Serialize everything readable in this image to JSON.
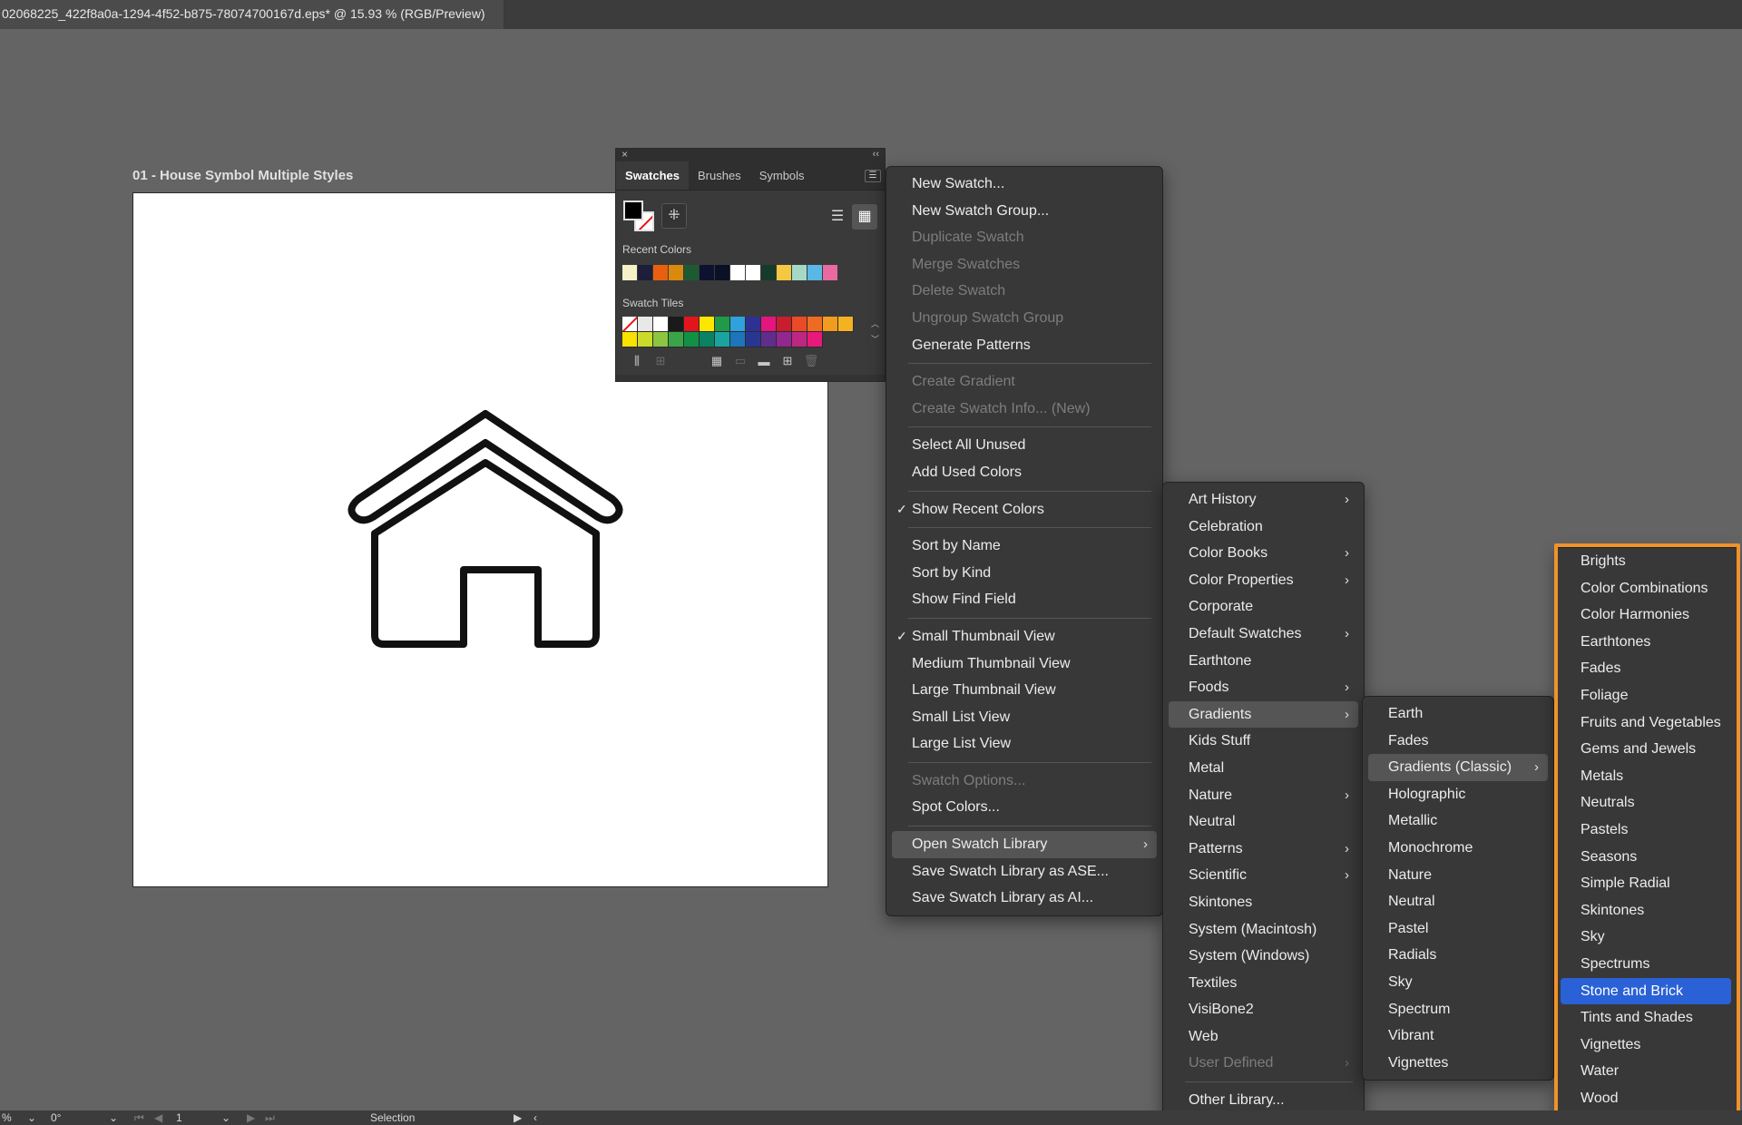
{
  "document": {
    "tab_title": "02068225_422f8a0a-1294-4f52-b875-78074700167d.eps* @ 15.93 % (RGB/Preview)",
    "artboard_label": "01 - House Symbol Multiple Styles"
  },
  "swatches_panel": {
    "close_glyph": "×",
    "collapse_glyph": "‹‹",
    "tabs": [
      "Swatches",
      "Brushes",
      "Symbols"
    ],
    "recent_colors_label": "Recent Colors",
    "swatch_tiles_label": "Swatch Tiles",
    "recent_colors": [
      "#f5f1c8",
      "#1c1e3a",
      "#e8600e",
      "#d98a0e",
      "#1d5a33",
      "#0d1230",
      "#0a1026",
      "#ffffff",
      "#ffffff",
      "#173b2a",
      "#f4c842",
      "#a6d8c8",
      "#5ab8e4",
      "#e86aa0"
    ],
    "tile_colors": [
      "none",
      "#e8e8e8",
      "#ffffff",
      "#1a1a1a",
      "#e1161c",
      "#ffe600",
      "#1f9a48",
      "#2da2dc",
      "#2e3192",
      "#e4167e",
      "#c91d2d",
      "#ea4b26",
      "#ef6b22",
      "#f29c1f",
      "#f4b223",
      "#f9e100",
      "#cbdb2a",
      "#8ec540",
      "#3aa548",
      "#119146",
      "#0a8264",
      "#1aa4a0",
      "#1d75bc",
      "#27378f",
      "#5f2e8d",
      "#91278f",
      "#bd2783",
      "#e7197c"
    ]
  },
  "main_menu": {
    "items": [
      {
        "label": "New Swatch...",
        "disabled": false
      },
      {
        "label": "New Swatch Group...",
        "disabled": false
      },
      {
        "label": "Duplicate Swatch",
        "disabled": true
      },
      {
        "label": "Merge Swatches",
        "disabled": true
      },
      {
        "label": "Delete Swatch",
        "disabled": true
      },
      {
        "label": "Ungroup Swatch Group",
        "disabled": true
      },
      {
        "label": "Generate Patterns",
        "disabled": false
      },
      {
        "label": "Create Gradient",
        "disabled": true
      },
      {
        "label": "Create Swatch Info... (New)",
        "disabled": true
      },
      {
        "label": "Select All Unused",
        "disabled": false
      },
      {
        "label": "Add Used Colors",
        "disabled": false
      },
      {
        "label": "Show Recent Colors",
        "checked": true
      },
      {
        "label": "Sort by Name",
        "disabled": false
      },
      {
        "label": "Sort by Kind",
        "disabled": false
      },
      {
        "label": "Show Find Field",
        "disabled": false
      },
      {
        "label": "Small Thumbnail View",
        "checked": true
      },
      {
        "label": "Medium Thumbnail View",
        "disabled": false
      },
      {
        "label": "Large Thumbnail View",
        "disabled": false
      },
      {
        "label": "Small List View",
        "disabled": false
      },
      {
        "label": "Large List View",
        "disabled": false
      },
      {
        "label": "Swatch Options...",
        "disabled": true
      },
      {
        "label": "Spot Colors...",
        "disabled": false
      },
      {
        "label": "Open Swatch Library",
        "submenu": true,
        "highlight": true
      },
      {
        "label": "Save Swatch Library as ASE...",
        "disabled": false
      },
      {
        "label": "Save Swatch Library as AI...",
        "disabled": false
      }
    ],
    "check_glyph": "✓",
    "chevron_glyph": "›"
  },
  "library_menu": {
    "items": [
      {
        "label": "Art History",
        "submenu": true
      },
      {
        "label": "Celebration"
      },
      {
        "label": "Color Books",
        "submenu": true
      },
      {
        "label": "Color Properties",
        "submenu": true
      },
      {
        "label": "Corporate"
      },
      {
        "label": "Default Swatches",
        "submenu": true
      },
      {
        "label": "Earthtone"
      },
      {
        "label": "Foods",
        "submenu": true
      },
      {
        "label": "Gradients",
        "submenu": true,
        "highlight": true
      },
      {
        "label": "Kids Stuff"
      },
      {
        "label": "Metal"
      },
      {
        "label": "Nature",
        "submenu": true
      },
      {
        "label": "Neutral"
      },
      {
        "label": "Patterns",
        "submenu": true
      },
      {
        "label": "Scientific",
        "submenu": true
      },
      {
        "label": "Skintones"
      },
      {
        "label": "System (Macintosh)"
      },
      {
        "label": "System (Windows)"
      },
      {
        "label": "Textiles"
      },
      {
        "label": "VisiBone2"
      },
      {
        "label": "Web"
      },
      {
        "label": "User Defined",
        "submenu": true,
        "disabled": true
      },
      {
        "label": "Other Library..."
      }
    ]
  },
  "gradients_menu": {
    "items": [
      {
        "label": "Earth"
      },
      {
        "label": "Fades"
      },
      {
        "label": "Gradients (Classic)",
        "submenu": true,
        "highlight": true
      },
      {
        "label": "Holographic"
      },
      {
        "label": "Metallic"
      },
      {
        "label": "Monochrome"
      },
      {
        "label": "Nature"
      },
      {
        "label": "Neutral"
      },
      {
        "label": "Pastel"
      },
      {
        "label": "Radials"
      },
      {
        "label": "Sky"
      },
      {
        "label": "Spectrum"
      },
      {
        "label": "Vibrant"
      },
      {
        "label": "Vignettes"
      }
    ]
  },
  "classic_menu": {
    "items": [
      {
        "label": "Brights"
      },
      {
        "label": "Color Combinations"
      },
      {
        "label": "Color Harmonies"
      },
      {
        "label": "Earthtones"
      },
      {
        "label": "Fades"
      },
      {
        "label": "Foliage"
      },
      {
        "label": "Fruits and Vegetables"
      },
      {
        "label": "Gems and Jewels"
      },
      {
        "label": "Metals"
      },
      {
        "label": "Neutrals"
      },
      {
        "label": "Pastels"
      },
      {
        "label": "Seasons"
      },
      {
        "label": "Simple Radial"
      },
      {
        "label": "Skintones"
      },
      {
        "label": "Sky"
      },
      {
        "label": "Spectrums"
      },
      {
        "label": "Stone and Brick",
        "selected": true
      },
      {
        "label": "Tints and Shades"
      },
      {
        "label": "Vignettes"
      },
      {
        "label": "Water"
      },
      {
        "label": "Wood"
      }
    ]
  },
  "status_bar": {
    "zoom": "%",
    "rotation": "0°",
    "artboard_number": "1",
    "tool": "Selection"
  },
  "colors": {
    "highlight_blue": "#2a61d6",
    "annotation_orange": "#f0922a"
  }
}
